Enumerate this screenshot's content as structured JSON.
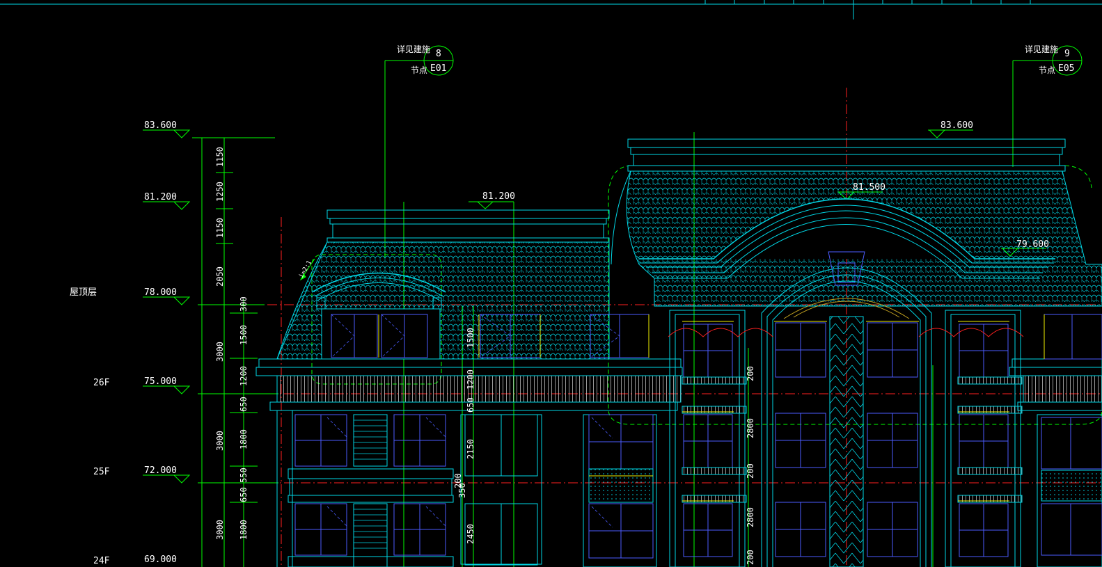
{
  "drawing": {
    "colors": {
      "background": "#000000",
      "outline": "#00d7e6",
      "guide": "#00ff00",
      "axis": "#ff0000",
      "window_frame": "#4b5cff",
      "accent": "#f0f000",
      "text": "#ffffff"
    },
    "elevations_left": [
      {
        "value": "83.600",
        "floor": ""
      },
      {
        "value": "81.200",
        "floor": ""
      },
      {
        "value": "78.000",
        "floor": "屋顶层"
      },
      {
        "value": "75.000",
        "floor": "26F"
      },
      {
        "value": "72.000",
        "floor": "25F"
      },
      {
        "value": "69.000",
        "floor": "24F"
      }
    ],
    "elevations_in_drawing": [
      {
        "value": "81.200"
      },
      {
        "value": "83.600"
      },
      {
        "value": "81.500"
      },
      {
        "value": "79.600"
      }
    ],
    "dimensions_vertical_inner": [
      "1150",
      "1250",
      "1150",
      "2050",
      "300",
      "1500",
      "1200",
      "650",
      "1800",
      "550",
      "650",
      "1800"
    ],
    "dimensions_vertical_outer": [
      "3000",
      "3000",
      "3000"
    ],
    "dimensions_in_facade": [
      "1500",
      "1200",
      "650",
      "2150",
      "200",
      "350",
      "2450",
      "200",
      "2800",
      "200",
      "2800",
      "200"
    ],
    "detail_callouts": [
      {
        "note_top": "详见建施",
        "note_bottom": "节点",
        "number": "8",
        "sheet": "E01"
      },
      {
        "note_top": "详见建施",
        "note_bottom": "节点",
        "number": "9",
        "sheet": "E05"
      }
    ],
    "slope_label": "i=2:1"
  }
}
